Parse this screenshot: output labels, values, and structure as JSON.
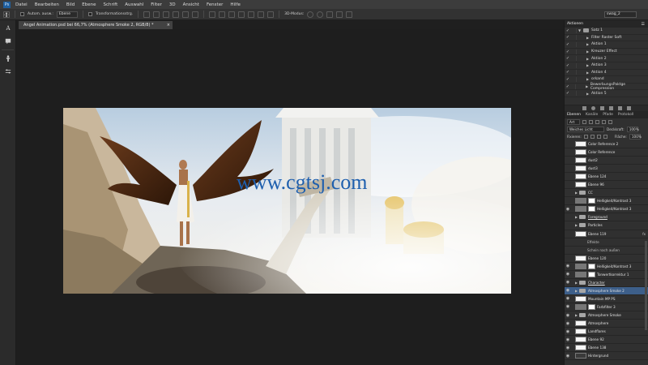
{
  "menu": {
    "logo": "Ps",
    "items": [
      "Datei",
      "Bearbeiten",
      "Bild",
      "Ebene",
      "Schrift",
      "Auswahl",
      "Filter",
      "3D",
      "Ansicht",
      "Fenster",
      "Hilfe"
    ]
  },
  "options": {
    "auto_select_label": "Autom. ausw.:",
    "auto_select_value": "Ebene",
    "transform_label": "Transformationsstrg.",
    "mode_3d_label": "3D-Modus:",
    "workspace": "swag_2"
  },
  "document": {
    "tab_title": "Angel Animation.psd bei 66,7% (Atmosphere Smoke 2, RGB/8) *",
    "close_glyph": "×",
    "watermark": "www.cgtsj.com"
  },
  "actions_panel": {
    "tab": "Aktionen",
    "rows": [
      {
        "label": "Satz 1",
        "kind": "set"
      },
      {
        "label": "Filter Raster Soft",
        "kind": "action"
      },
      {
        "label": "Aktion 1",
        "kind": "action"
      },
      {
        "label": "Kreuzer Effect",
        "kind": "action"
      },
      {
        "label": "Aktion 2",
        "kind": "action"
      },
      {
        "label": "Aktion 3",
        "kind": "action"
      },
      {
        "label": "Aktion 4",
        "kind": "action"
      },
      {
        "label": "orkand",
        "kind": "action"
      },
      {
        "label": "BewerbungsPaktge Compression",
        "kind": "action"
      },
      {
        "label": "Aktion 5",
        "kind": "action"
      }
    ]
  },
  "layers_panel": {
    "tabs": [
      "Ebenen",
      "Kanäle",
      "Pfade",
      "Protokoll"
    ],
    "filter_kind": "Art",
    "blend_mode": "Weiches Licht",
    "opacity_label": "Deckkraft:",
    "opacity_value": "100%",
    "lock_label": "Fixieren:",
    "fill_label": "Fläche:",
    "fill_value": "100%",
    "rows": [
      {
        "name": "Color Reference 2",
        "type": "layer",
        "eye": false
      },
      {
        "name": "Color Reference",
        "type": "layer",
        "eye": false
      },
      {
        "name": "dust2",
        "type": "layer",
        "eye": false
      },
      {
        "name": "dust3",
        "type": "layer",
        "eye": false
      },
      {
        "name": "Ebene 124",
        "type": "layer",
        "eye": false
      },
      {
        "name": "Ebene 96",
        "type": "layer",
        "eye": false,
        "purple": true
      },
      {
        "name": "CC",
        "type": "group",
        "eye": false,
        "purple": true
      },
      {
        "name": "Helligkeit/Kontrast 3",
        "type": "adjust",
        "eye": false
      },
      {
        "name": "Helligkeit/Kontrast 3",
        "type": "adjust",
        "eye": true
      },
      {
        "name": "Foreground",
        "type": "group",
        "eye": false,
        "underline": true
      },
      {
        "name": "Particles",
        "type": "group",
        "eye": false,
        "purple": true
      },
      {
        "name": "Ebene 119",
        "type": "layer",
        "eye": false,
        "fx": true
      },
      {
        "name": "Effekte",
        "type": "effect",
        "eye": false
      },
      {
        "name": "Schein nach außen",
        "type": "effect",
        "eye": false
      },
      {
        "name": "Ebene 120",
        "type": "layer",
        "eye": false
      },
      {
        "name": "Helligkeit/Kontrast 3",
        "type": "adjust",
        "eye": true
      },
      {
        "name": "Tonwertkorrektur 1",
        "type": "adjust",
        "eye": true
      },
      {
        "name": "Character",
        "type": "group",
        "eye": true,
        "underline": true
      },
      {
        "name": "Atmosphere Smoke 2",
        "type": "group",
        "eye": true,
        "selected": true
      },
      {
        "name": "Mountain MP PS",
        "type": "layer",
        "eye": true
      },
      {
        "name": "Farbfilter 3",
        "type": "adjust",
        "eye": true
      },
      {
        "name": "Atmosphere Smoke",
        "type": "group",
        "eye": true
      },
      {
        "name": "Atmosphere",
        "type": "layer",
        "eye": true
      },
      {
        "name": "Landflares",
        "type": "layer",
        "eye": true
      },
      {
        "name": "Ebene 92",
        "type": "layer",
        "eye": true
      },
      {
        "name": "Ebene 138",
        "type": "layer",
        "eye": true
      },
      {
        "name": "Hintergrund",
        "type": "layer",
        "eye": true,
        "dark": true
      }
    ]
  },
  "colors": {
    "selection": "#3d5f8a",
    "label_purple": "#7a3fc0",
    "watermark_blue": "#1e5fae"
  }
}
